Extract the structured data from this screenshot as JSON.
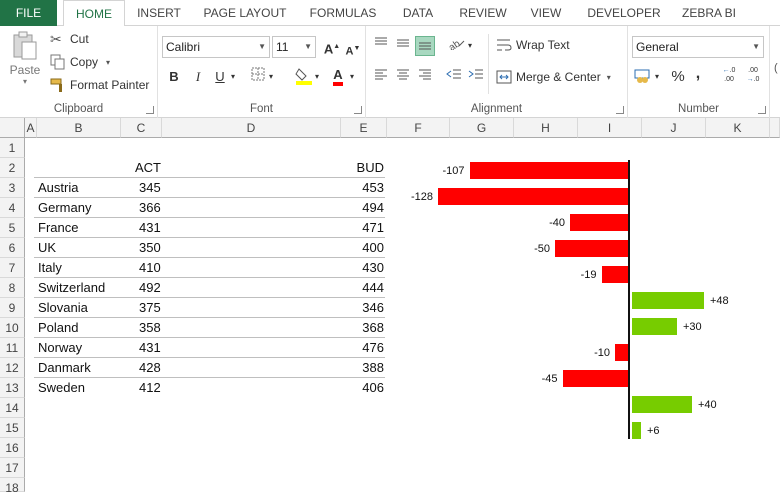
{
  "tabs": [
    "FILE",
    "HOME",
    "INSERT",
    "PAGE LAYOUT",
    "FORMULAS",
    "DATA",
    "REVIEW",
    "VIEW",
    "DEVELOPER",
    "ZEBRA BI"
  ],
  "ribbon": {
    "clipboard": {
      "label": "Clipboard",
      "paste": "Paste",
      "cut": "Cut",
      "copy": "Copy",
      "format_painter": "Format Painter"
    },
    "font": {
      "label": "Font",
      "name": "Calibri",
      "size": "11",
      "bold": "B",
      "italic": "I",
      "underline": "U",
      "grow": "A",
      "shrink": "A",
      "font_color": "A"
    },
    "alignment": {
      "label": "Alignment",
      "wrap_text": "Wrap Text",
      "merge_center": "Merge & Center"
    },
    "number": {
      "label": "Number",
      "format": "General",
      "percent": "%",
      "comma": ",",
      "inc_decimal": ".00",
      "dec_decimal": ".00"
    }
  },
  "columns": [
    "A",
    "B",
    "C",
    "D",
    "E",
    "F",
    "G",
    "H",
    "I",
    "J",
    "K"
  ],
  "rows": [
    "1",
    "2",
    "3",
    "4",
    "5",
    "6",
    "7",
    "8",
    "9",
    "10",
    "11",
    "12",
    "13",
    "14",
    "15",
    "16",
    "17",
    "18"
  ],
  "table": {
    "header_act": "ACT",
    "header_bud": "BUD",
    "rows": [
      {
        "country": "Austria",
        "act": "345",
        "bud": "453"
      },
      {
        "country": "Germany",
        "act": "366",
        "bud": "494"
      },
      {
        "country": "France",
        "act": "431",
        "bud": "471"
      },
      {
        "country": "UK",
        "act": "350",
        "bud": "400"
      },
      {
        "country": "Italy",
        "act": "410",
        "bud": "430"
      },
      {
        "country": "Switzerland",
        "act": "492",
        "bud": "444"
      },
      {
        "country": "Slovania",
        "act": "375",
        "bud": "346"
      },
      {
        "country": "Poland",
        "act": "358",
        "bud": "368"
      },
      {
        "country": "Norway",
        "act": "431",
        "bud": "476"
      },
      {
        "country": "Danmark",
        "act": "428",
        "bud": "388"
      },
      {
        "country": "Sweden",
        "act": "412",
        "bud": "406"
      }
    ]
  },
  "chart_data": {
    "type": "bar",
    "categories": [
      "Austria",
      "Germany",
      "France",
      "UK",
      "Italy",
      "Switzerland",
      "Slovania",
      "Poland",
      "Norway",
      "Danmark",
      "Sweden"
    ],
    "values": [
      -107,
      -128,
      -40,
      -50,
      -19,
      48,
      30,
      -10,
      -45,
      40,
      6
    ],
    "labels": [
      "-107",
      "-128",
      "-40",
      "-50",
      "-19",
      "+48",
      "+30",
      "-10",
      "-45",
      "+40",
      "+6"
    ],
    "negative_color": "#ff0000",
    "positive_color": "#77cc00"
  }
}
